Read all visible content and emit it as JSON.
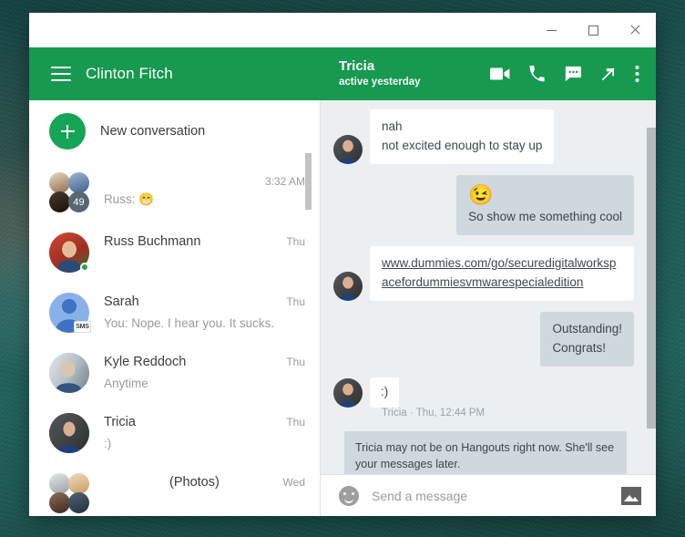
{
  "window": {
    "controls": [
      {
        "name": "minimize",
        "label": "—"
      },
      {
        "name": "maximize",
        "label": "□"
      },
      {
        "name": "close",
        "label": "✕"
      }
    ]
  },
  "theme": {
    "green": "#17994f",
    "fab_green": "#16a457",
    "chat_bg": "#eceff1",
    "bubble_out": "#cfd8dc",
    "bubble_in": "#ffffff",
    "presence_online": "#25a63f"
  },
  "appbar": {
    "menu_icon": "hamburger-menu-icon",
    "title": "Clinton Fitch"
  },
  "conversation_header": {
    "peer_name": "Tricia",
    "peer_status": "active yesterday",
    "actions": [
      {
        "name": "video-call-icon",
        "label": "Video call"
      },
      {
        "name": "phone-call-icon",
        "label": "Phone call"
      },
      {
        "name": "message-icon",
        "label": "Message"
      },
      {
        "name": "pop-out-icon",
        "label": "Open in new window"
      },
      {
        "name": "overflow-menu-icon",
        "label": "More options"
      }
    ]
  },
  "conversation_list": {
    "new_conversation": {
      "label": "New conversation",
      "icon": "plus-icon"
    },
    "items": [
      {
        "avatar_type": "group",
        "count_badge": "49",
        "title": "",
        "snippet": "Russ: 😁",
        "time": "3:32 AM",
        "online": false,
        "sms": false
      },
      {
        "avatar_type": "photo",
        "title": "Russ Buchmann",
        "snippet": "",
        "time": "Thu",
        "online": true,
        "sms": false
      },
      {
        "avatar_type": "default",
        "title": "Sarah",
        "snippet": "You: Nope.  I hear you.  It sucks.",
        "time": "Thu",
        "online": false,
        "sms": true
      },
      {
        "avatar_type": "photo",
        "title": "Kyle Reddoch",
        "snippet": "Anytime",
        "time": "Thu",
        "online": false,
        "sms": false
      },
      {
        "avatar_type": "photo",
        "title": "Tricia",
        "snippet": ":)",
        "time": "Thu",
        "online": false,
        "sms": false
      },
      {
        "avatar_type": "group",
        "title": "",
        "snippet": "(Photos)",
        "time": "Wed",
        "online": false,
        "sms": false
      }
    ]
  },
  "chat": {
    "messages": [
      {
        "direction": "inbound",
        "avatar": true,
        "lines": [
          "nah",
          "not excited enough to stay up"
        ]
      },
      {
        "direction": "outbound",
        "avatar": false,
        "emoji": "😉",
        "lines": [
          "So show me something cool"
        ]
      },
      {
        "direction": "inbound",
        "avatar": true,
        "link": "www.dummies.com/go/securedigitalworkspacefordummiesvmwarespecialedition",
        "lines": []
      },
      {
        "direction": "outbound",
        "avatar": false,
        "lines": [
          "Outstanding!",
          "Congrats!"
        ]
      },
      {
        "direction": "inbound",
        "avatar": true,
        "lines": [
          ":)"
        ],
        "meta": "Tricia · Thu, 12:44 PM"
      }
    ],
    "system_note": "Tricia may not be on Hangouts right now. She'll see your messages later."
  },
  "composer": {
    "emoji_icon": "emoji-smiley-icon",
    "placeholder": "Send a message",
    "value": "",
    "image_icon": "insert-image-icon"
  }
}
